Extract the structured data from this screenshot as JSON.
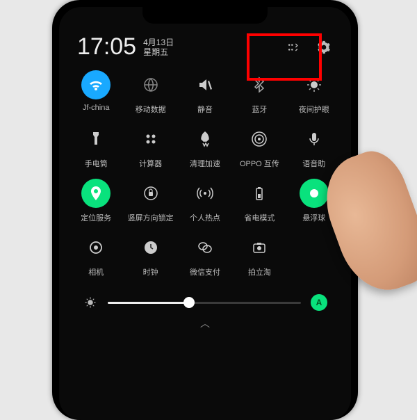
{
  "header": {
    "time": "17:05",
    "date_line1": "4月13日",
    "date_line2": "星期五",
    "edit_icon": "edit-icon",
    "settings_icon": "settings-icon"
  },
  "tiles": [
    [
      {
        "name": "wifi",
        "label": "Jf-china",
        "active": "blue",
        "icon": "wifi"
      },
      {
        "name": "mobile-data",
        "label": "移动数据",
        "icon": "globe"
      },
      {
        "name": "mute",
        "label": "静音",
        "icon": "mute"
      },
      {
        "name": "bluetooth",
        "label": "蓝牙",
        "icon": "bt"
      },
      {
        "name": "night-shield",
        "label": "夜间护眼",
        "icon": "eye"
      }
    ],
    [
      {
        "name": "flashlight",
        "label": "手电筒",
        "icon": "torch"
      },
      {
        "name": "calculator",
        "label": "计算器",
        "icon": "calc"
      },
      {
        "name": "clean-boost",
        "label": "清理加速",
        "icon": "rocket"
      },
      {
        "name": "oppo-share",
        "label": "OPPO 互传",
        "icon": "radar"
      },
      {
        "name": "voice-assist",
        "label": "语音助",
        "icon": "mic"
      }
    ],
    [
      {
        "name": "location",
        "label": "定位服务",
        "active": "green",
        "icon": "pin"
      },
      {
        "name": "portrait-lock",
        "label": "竖屏方向锁定",
        "icon": "lock"
      },
      {
        "name": "hotspot",
        "label": "个人热点",
        "icon": "hotspot"
      },
      {
        "name": "power-save",
        "label": "省电模式",
        "icon": "battery"
      },
      {
        "name": "float-ball",
        "label": "悬浮球",
        "active": "green",
        "icon": "dot"
      }
    ],
    [
      {
        "name": "camera",
        "label": "相机",
        "icon": "camera"
      },
      {
        "name": "clock",
        "label": "时钟",
        "icon": "clock"
      },
      {
        "name": "wechat-pay",
        "label": "微信支付",
        "icon": "wxpay"
      },
      {
        "name": "pailitao",
        "label": "拍立淘",
        "icon": "cam2"
      },
      {
        "name": "blank",
        "label": "",
        "icon": ""
      }
    ]
  ],
  "brightness": {
    "value": 42,
    "auto_label": "A"
  },
  "colors": {
    "blue": "#19a9ff",
    "green": "#09e27d",
    "red": "#f00"
  }
}
